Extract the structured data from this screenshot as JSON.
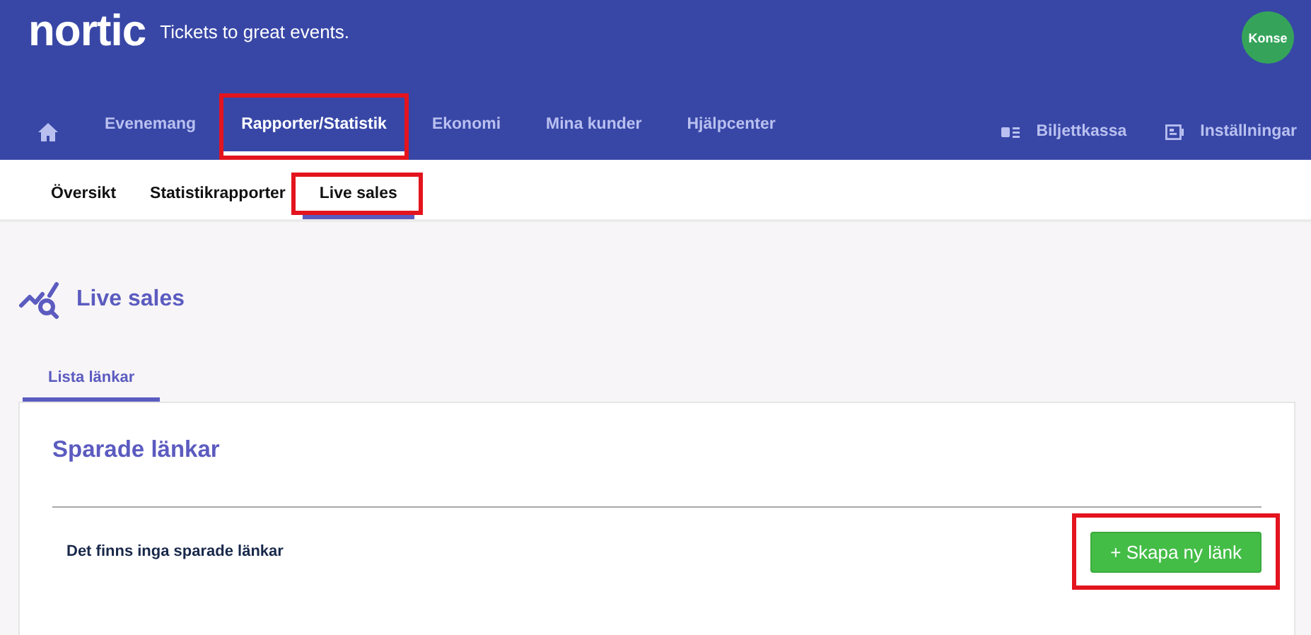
{
  "brand": {
    "logo": "nortic",
    "tagline": "Tickets to great events."
  },
  "user": {
    "avatar": "Konse"
  },
  "main_nav": [
    {
      "label": "Evenemang",
      "selected": false,
      "highlighted": false
    },
    {
      "label": "Rapporter/Statistik",
      "selected": true,
      "highlighted": true
    },
    {
      "label": "Ekonomi",
      "selected": false,
      "highlighted": false
    },
    {
      "label": "Mina kunder",
      "selected": false,
      "highlighted": false
    },
    {
      "label": "Hjälpcenter",
      "selected": false,
      "highlighted": false
    }
  ],
  "nav_actions": [
    {
      "label": "Biljettkassa",
      "kind": "register"
    },
    {
      "label": "Inställningar",
      "kind": "settings"
    }
  ],
  "sub_nav": [
    {
      "label": "Översikt",
      "selected": false,
      "highlighted": false
    },
    {
      "label": "Statistikrapporter",
      "selected": false,
      "highlighted": false
    },
    {
      "label": "Live sales",
      "selected": true,
      "highlighted": true
    }
  ],
  "page": {
    "title": "Live sales",
    "tabs": [
      {
        "label": "Lista länkar",
        "selected": true
      }
    ]
  },
  "card": {
    "title": "Sparade länkar",
    "empty_message": "Det finns inga sparade länkar",
    "button": {
      "label": "+ Skapa ny länk",
      "highlighted": true
    }
  }
}
